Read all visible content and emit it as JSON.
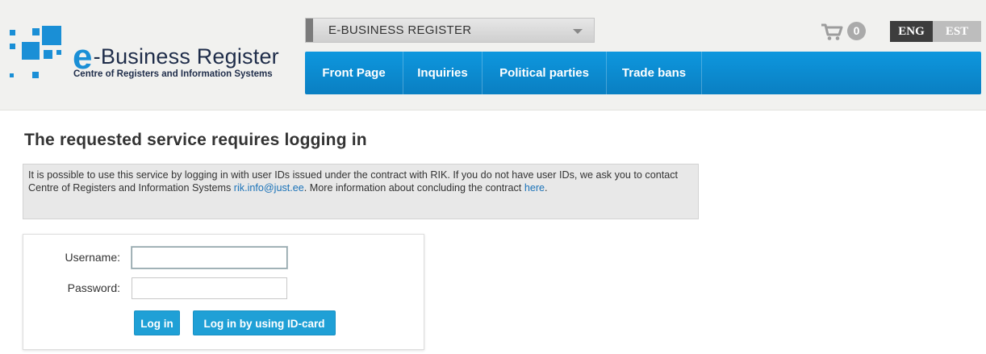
{
  "header": {
    "logo": {
      "title_letter": "e",
      "title_rest": "-Business Register",
      "subtitle": "Centre of Registers and Information Systems"
    },
    "register_select": {
      "selected": "E-BUSINESS REGISTER"
    },
    "nav": [
      {
        "label": "Front Page"
      },
      {
        "label": "Inquiries"
      },
      {
        "label": "Political parties"
      },
      {
        "label": "Trade bans"
      }
    ],
    "cart": {
      "count": "0",
      "icon": "shopping-cart-icon"
    },
    "languages": {
      "active": "ENG",
      "inactive": "EST"
    }
  },
  "main": {
    "title": "The requested service requires logging in",
    "notice": {
      "text_1": "It is possible to use this service by logging in with user IDs issued under the contract with RIK. If you do not have user IDs, we ask you to contact Centre of Registers and Information Systems ",
      "email": "rik.info@just.ee",
      "text_2": ". More information about concluding the contract ",
      "link": "here",
      "text_3": "."
    },
    "login": {
      "username_label": "Username:",
      "username_value": "",
      "password_label": "Password:",
      "password_value": "",
      "login_button": "Log in",
      "idcard_button": "Log in by using ID-card"
    }
  },
  "colors": {
    "brand_blue": "#1a8fd6",
    "nav_blue": "#0e97de",
    "button_blue": "#1fa0d6",
    "header_bg": "#f1f1ef",
    "notice_bg": "#e8e8e8"
  }
}
